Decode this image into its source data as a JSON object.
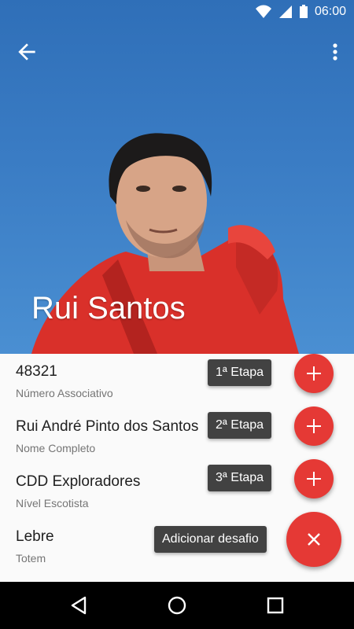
{
  "status_bar": {
    "time": "06:00",
    "icons": [
      "wifi-icon",
      "signal-icon",
      "battery-icon"
    ]
  },
  "toolbar": {
    "back_icon": "arrow-back-icon",
    "menu_icon": "more-vert-icon"
  },
  "profile": {
    "name": "Rui Santos"
  },
  "details": [
    {
      "value": "48321",
      "label": "Número Associativo"
    },
    {
      "value": "Rui André Pinto dos Santos",
      "label": "Nome Completo"
    },
    {
      "value": "CDD Exploradores",
      "label": "Nível Escotista"
    },
    {
      "value": "Lebre",
      "label": "Totem"
    }
  ],
  "fab_menu": {
    "items": [
      {
        "label": "1ª Etapa",
        "icon": "plus-icon"
      },
      {
        "label": "2ª Etapa",
        "icon": "plus-icon"
      },
      {
        "label": "3ª Etapa",
        "icon": "plus-icon"
      }
    ],
    "main": {
      "label": "Adicionar desafio",
      "icon": "close-icon"
    }
  },
  "nav_bar": {
    "icons": [
      "back-triangle-icon",
      "home-circle-icon",
      "recents-square-icon"
    ]
  },
  "colors": {
    "accent": "#e53935",
    "chip": "#424242",
    "hero": "#3a7cc4"
  }
}
